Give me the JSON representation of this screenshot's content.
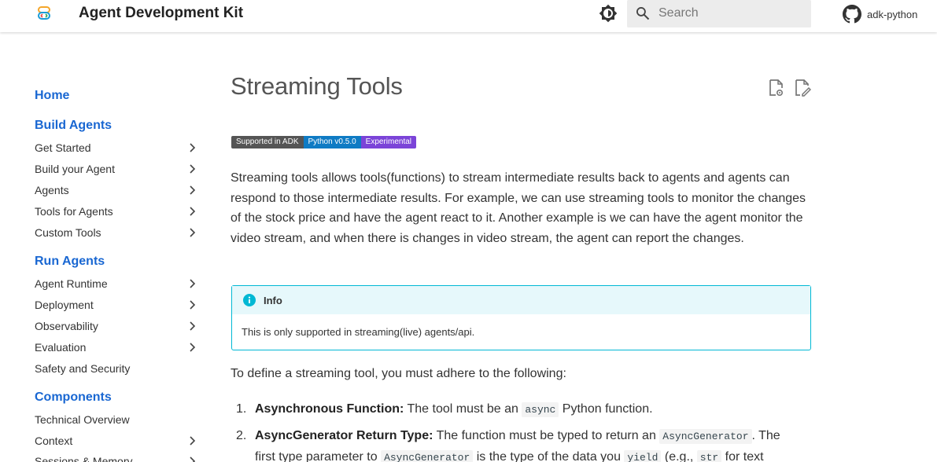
{
  "header": {
    "site_title": "Agent Development Kit",
    "search_placeholder": "Search",
    "repo_label": "adk-python",
    "icons": [
      "adk-logo-icon",
      "brightness-icon",
      "search-icon",
      "github-icon"
    ]
  },
  "sidebar": {
    "home": "Home",
    "sections": [
      {
        "title": "Build Agents",
        "items": [
          {
            "label": "Get Started",
            "chevron": true
          },
          {
            "label": "Build your Agent",
            "chevron": true
          },
          {
            "label": "Agents",
            "chevron": true
          },
          {
            "label": "Tools for Agents",
            "chevron": true
          },
          {
            "label": "Custom Tools",
            "chevron": true
          }
        ]
      },
      {
        "title": "Run Agents",
        "items": [
          {
            "label": "Agent Runtime",
            "chevron": true
          },
          {
            "label": "Deployment",
            "chevron": true
          },
          {
            "label": "Observability",
            "chevron": true
          },
          {
            "label": "Evaluation",
            "chevron": true
          },
          {
            "label": "Safety and Security",
            "chevron": false
          }
        ]
      },
      {
        "title": "Components",
        "items": [
          {
            "label": "Technical Overview",
            "chevron": false
          },
          {
            "label": "Context",
            "chevron": true
          },
          {
            "label": "Sessions & Memory",
            "chevron": true
          }
        ]
      }
    ]
  },
  "main": {
    "title": "Streaming Tools",
    "badges": [
      "Supported in ADK",
      "Python v0.5.0",
      "Experimental"
    ],
    "intro": "Streaming tools allows tools(functions) to stream intermediate results back to agents and agents can respond to those intermediate results. For example, we can use streaming tools to monitor the changes of the stock price and have the agent react to it. Another example is we can have the agent monitor the video stream, and when there is changes in video stream, the agent can report the changes.",
    "admonition": {
      "title": "Info",
      "body": "This is only supported in streaming(live) agents/api."
    },
    "lead": "To define a streaming tool, you must adhere to the following:",
    "rules": [
      {
        "num": "1.",
        "heading": "Asynchronous Function:",
        "t1": " The tool must be an ",
        "code1": "async",
        "t2": " Python function."
      },
      {
        "num": "2.",
        "heading": "AsyncGenerator Return Type:",
        "t1": " The function must be typed to return an ",
        "code1": "AsyncGenerator",
        "t2": ". The first type parameter to ",
        "code2": "AsyncGenerator",
        "t3": " is the type of the data you ",
        "code3": "yield",
        "t4": " (e.g., ",
        "code4": "str",
        "t5": " for text"
      }
    ]
  },
  "colors": {
    "link": "#1967d2",
    "info_border": "#00b8d4",
    "info_header_bg": "#e6f8fb",
    "badge_grey": "#555555",
    "badge_blue": "#0f7bc4",
    "badge_purple": "#7b44d8"
  }
}
